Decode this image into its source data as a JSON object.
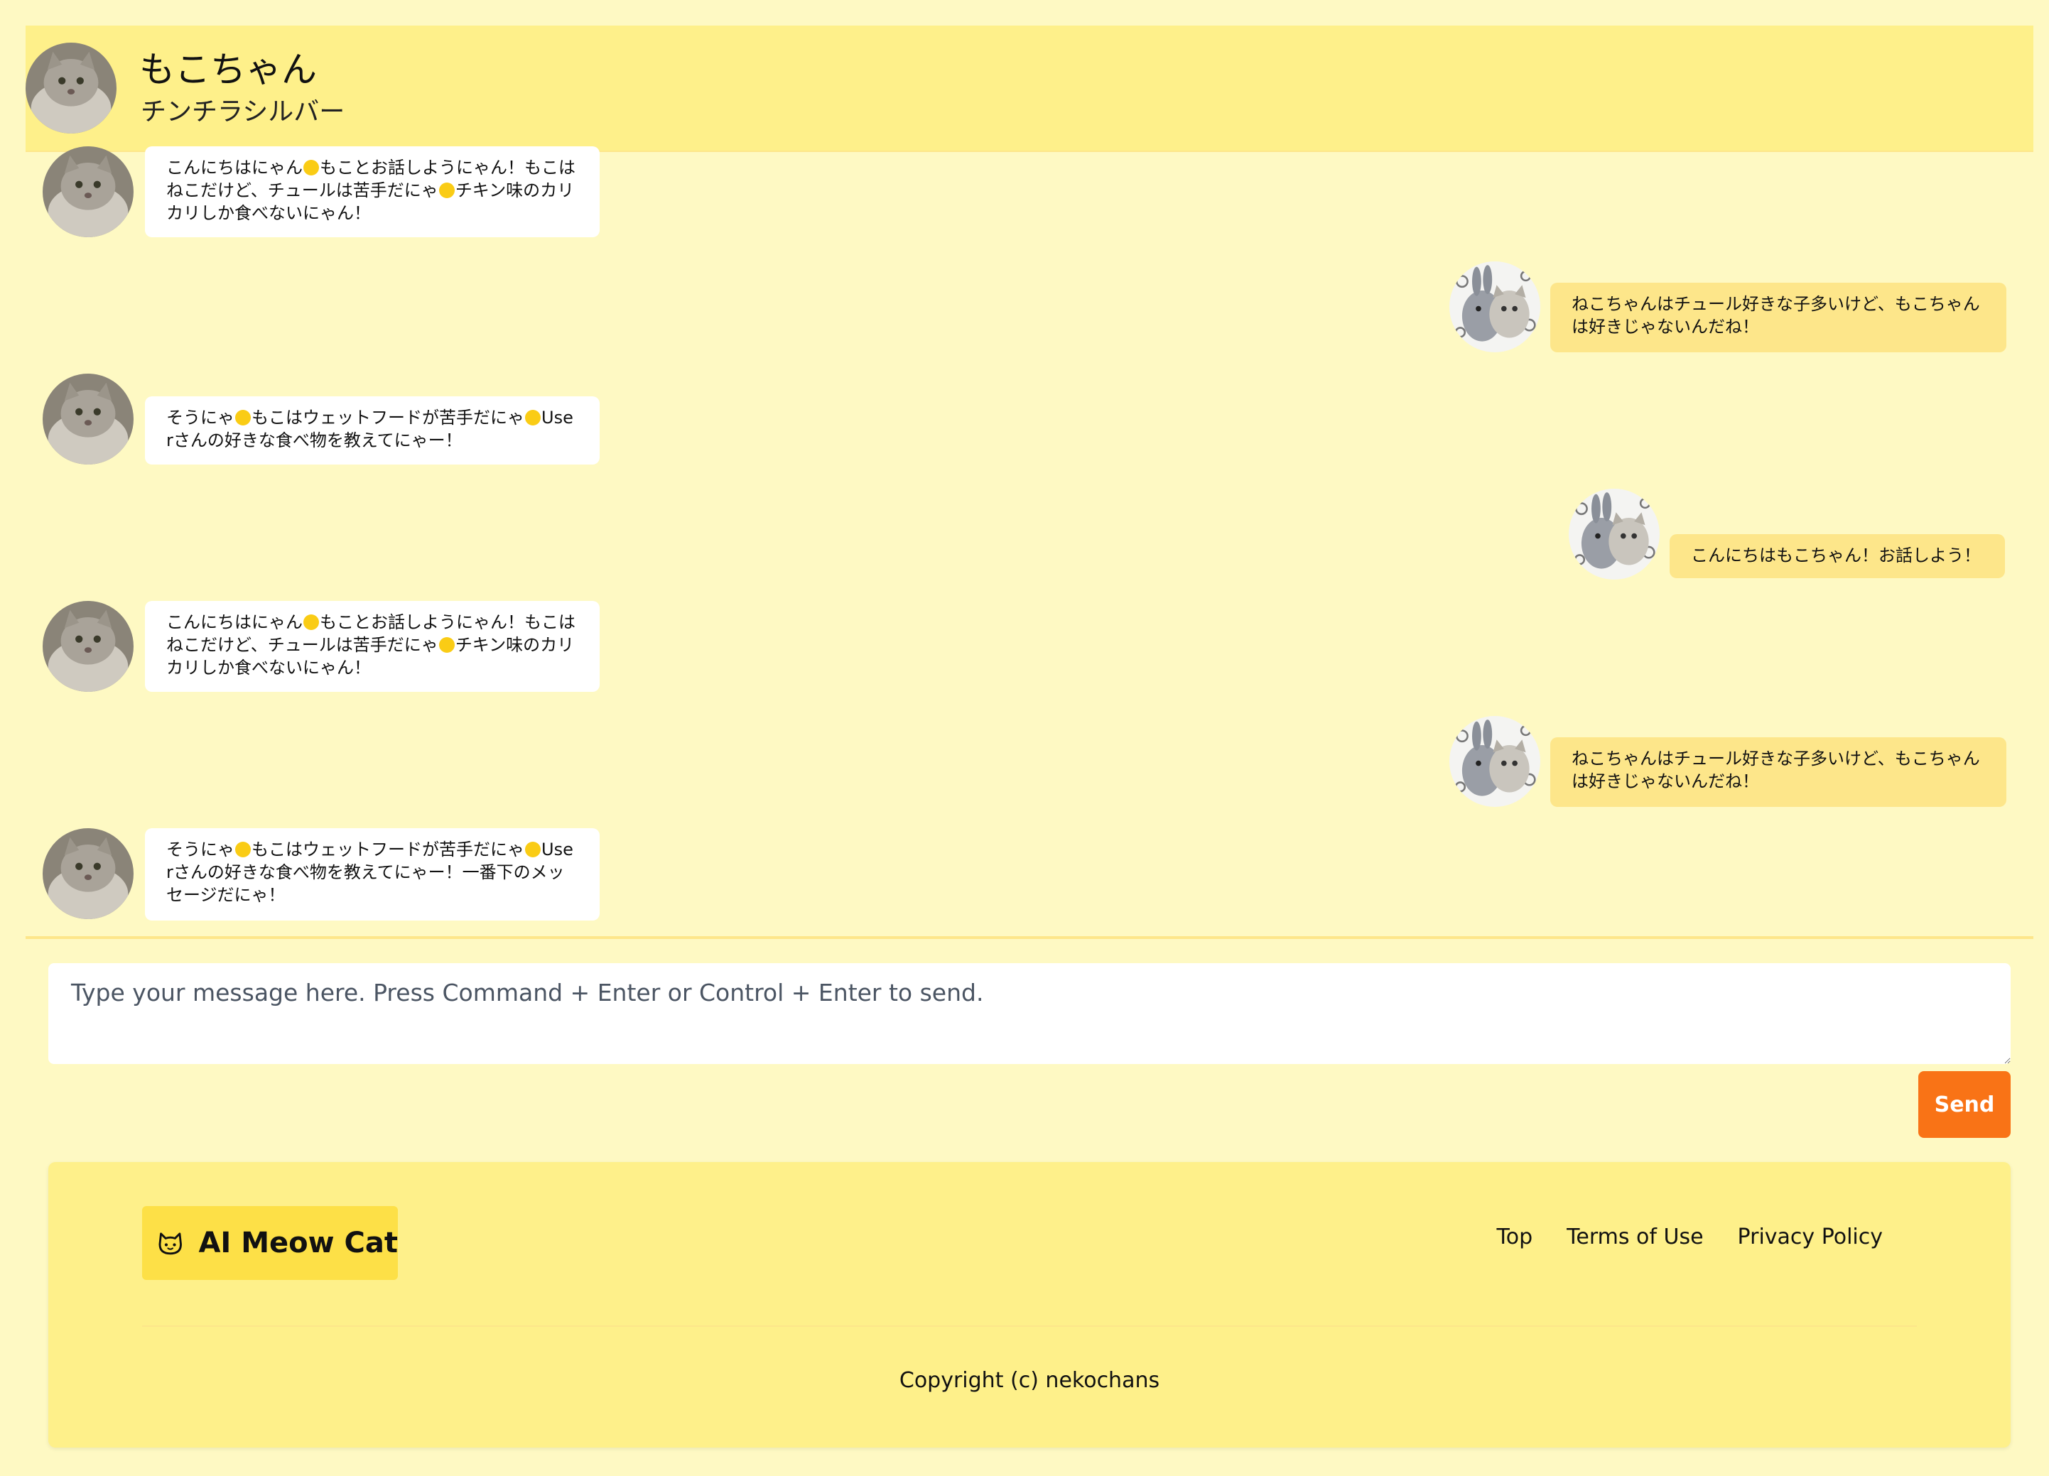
{
  "header": {
    "name": "もこちゃん",
    "breed": "チンチラシルバー"
  },
  "messages": [
    {
      "sender": "cat",
      "parts": [
        "こんにちはにゃん",
        "もことお話しようにゃん！もこはねこだけど、チュールは苦手だにゃ",
        "チキン味のカリカリしか食べないにゃん！"
      ]
    },
    {
      "sender": "user",
      "parts": [
        "ねこちゃんはチュール好きな子多いけど、もこちゃんは好きじゃないんだね！"
      ]
    },
    {
      "sender": "cat",
      "parts": [
        "そうにゃ",
        "もこはウェットフードが苦手だにゃ",
        "Userさんの好きな食べ物を教えてにゃー！"
      ]
    },
    {
      "sender": "user",
      "parts": [
        "こんにちはもこちゃん！お話しよう！"
      ]
    },
    {
      "sender": "cat",
      "parts": [
        "こんにちはにゃん",
        "もことお話しようにゃん！もこはねこだけど、チュールは苦手だにゃ",
        "チキン味のカリカリしか食べないにゃん！"
      ]
    },
    {
      "sender": "user",
      "parts": [
        "ねこちゃんはチュール好きな子多いけど、もこちゃんは好きじゃないんだね！"
      ]
    },
    {
      "sender": "cat",
      "parts": [
        "そうにゃ",
        "もこはウェットフードが苦手だにゃ",
        "Userさんの好きな食べ物を教えてにゃー！一番下のメッセージだにゃ！"
      ]
    }
  ],
  "composer": {
    "placeholder": "Type your message here. Press Command + Enter or Control + Enter to send.",
    "send_label": "Send"
  },
  "footer": {
    "brand": "AI Meow Cat",
    "links": [
      "Top",
      "Terms of Use",
      "Privacy Policy"
    ],
    "copyright": "Copyright (c) nekochans"
  },
  "colors": {
    "page_bg": "#fef9c3",
    "header_bg": "#fef08a",
    "user_bubble": "#fde68a",
    "cat_bubble": "#ffffff",
    "send_button": "#f97316",
    "brand_bg": "#fde047"
  },
  "icons": {
    "emoji": "cat-face-icon",
    "brand": "cat-face-icon"
  }
}
